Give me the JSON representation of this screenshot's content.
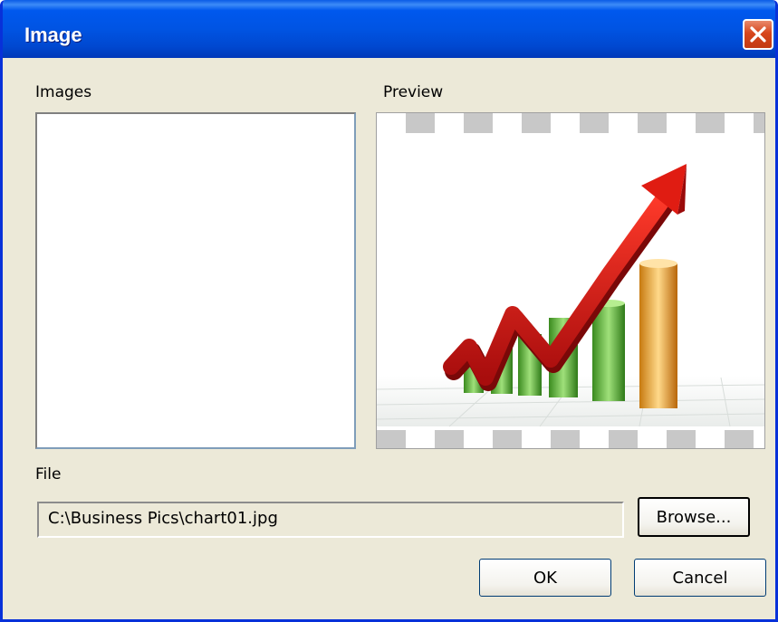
{
  "window": {
    "title": "Image",
    "close_icon": "close-icon"
  },
  "images_panel": {
    "label": "Images",
    "items": []
  },
  "preview_panel": {
    "label": "Preview",
    "image": "chart-growth-arrow-image"
  },
  "file": {
    "label": "File",
    "value": "C:\\Business Pics\\chart01.jpg"
  },
  "buttons": {
    "browse": "Browse...",
    "ok": "OK",
    "cancel": "Cancel"
  },
  "colors": {
    "title_bar": "#0054e3",
    "window_bg": "#ece9d8",
    "close_red": "#d7461c"
  }
}
